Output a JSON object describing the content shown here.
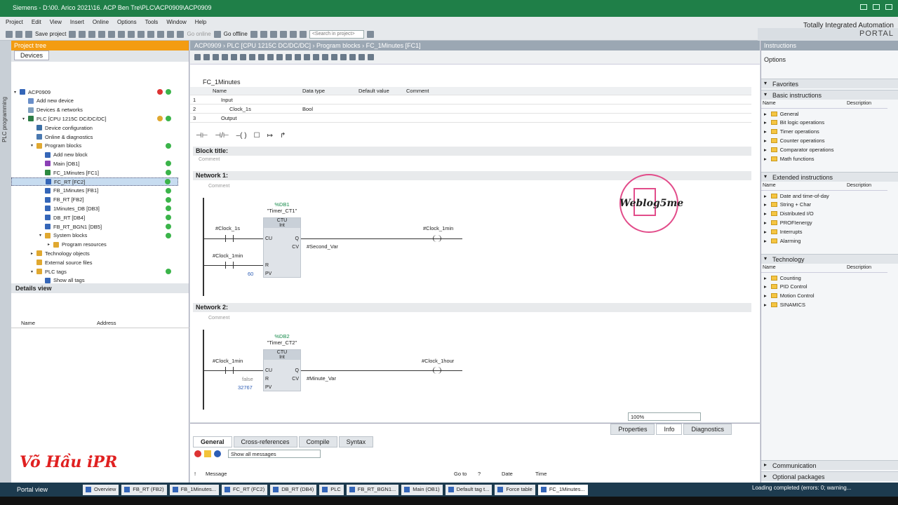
{
  "window": {
    "title": "Siemens - D:\\00. Arico 2021\\16. ACP Ben Tre\\PLC\\ACP0909\\ACP0909"
  },
  "menu": [
    "Project",
    "Edit",
    "View",
    "Insert",
    "Online",
    "Options",
    "Tools",
    "Window",
    "Help"
  ],
  "toolbar": {
    "save": "Save project",
    "go_online": "Go online",
    "go_offline": "Go offline",
    "search_placeholder": "<Search in project>"
  },
  "brand": {
    "line1": "Totally Integrated Automation",
    "line2": "PORTAL"
  },
  "leftstrip": {
    "label": "PLC programming"
  },
  "project_tree": {
    "header": "Project tree",
    "tab": "Devices",
    "items": [
      {
        "label": "ACP0909",
        "indent": 0,
        "status": "both"
      },
      {
        "label": "Add new device",
        "indent": 1,
        "status": ""
      },
      {
        "label": "Devices & networks",
        "indent": 1,
        "status": ""
      },
      {
        "label": "PLC [CPU 1215C DC/DC/DC]",
        "indent": 1,
        "status": "both2"
      },
      {
        "label": "Device configuration",
        "indent": 2,
        "status": ""
      },
      {
        "label": "Online & diagnostics",
        "indent": 2,
        "status": ""
      },
      {
        "label": "Program blocks",
        "indent": 2,
        "status": "ok"
      },
      {
        "label": "Add new block",
        "indent": 3,
        "status": ""
      },
      {
        "label": "Main [OB1]",
        "indent": 3,
        "status": "ok"
      },
      {
        "label": "FC_1Minutes [FC1]",
        "indent": 3,
        "status": "ok"
      },
      {
        "label": "FC_RT [FC2]",
        "indent": 3,
        "status": "ok",
        "selected": true
      },
      {
        "label": "FB_1Minutes [FB1]",
        "indent": 3,
        "status": "ok"
      },
      {
        "label": "FB_RT [FB2]",
        "indent": 3,
        "status": "ok"
      },
      {
        "label": "1Minutes_DB [DB3]",
        "indent": 3,
        "status": "ok"
      },
      {
        "label": "DB_RT [DB4]",
        "indent": 3,
        "status": "ok"
      },
      {
        "label": "FB_RT_BGN1 [DB5]",
        "indent": 3,
        "status": "ok"
      },
      {
        "label": "System blocks",
        "indent": 3,
        "status": "ok"
      },
      {
        "label": "Program resources",
        "indent": 4,
        "status": ""
      },
      {
        "label": "Technology objects",
        "indent": 2,
        "status": ""
      },
      {
        "label": "External source files",
        "indent": 2,
        "status": ""
      },
      {
        "label": "PLC tags",
        "indent": 2,
        "status": "ok"
      },
      {
        "label": "Show all tags",
        "indent": 3,
        "status": ""
      }
    ]
  },
  "details_view": {
    "header": "Details view",
    "col_name": "Name",
    "col_address": "Address"
  },
  "editor": {
    "breadcrumb": "ACP0909  ›  PLC [CPU 1215C DC/DC/DC]  ›  Program blocks  ›  FC_1Minutes [FC1]",
    "block_name": "FC_1Minutes",
    "interface_cols": [
      "Name",
      "Data type",
      "Default value",
      "Comment"
    ],
    "interface_rows": [
      {
        "num": "1",
        "name": "Input",
        "type": ""
      },
      {
        "num": "2",
        "name": "Clock_1s",
        "type": "Bool"
      },
      {
        "num": "3",
        "name": "Output",
        "type": ""
      }
    ],
    "block_title_label": "Block title:",
    "comment": "Comment",
    "network1": {
      "label": "Network 1:",
      "db_addr": "%DB1",
      "db_name": "\"Timer_CT1\"",
      "block_type": "CTU",
      "block_dtype": "Int",
      "pin_cu": "CU",
      "pin_r": "R",
      "pin_pv": "PV",
      "pin_q": "Q",
      "pin_cv": "CV",
      "in_cu": "#Clock_1s",
      "in_r": "#Clock_1min",
      "in_pv": "60",
      "out_q": "#Clock_1min",
      "out_cv": "#Second_Var"
    },
    "network2": {
      "label": "Network 2:",
      "db_addr": "%DB2",
      "db_name": "\"Timer_CT2\"",
      "block_type": "CTU",
      "block_dtype": "Int",
      "pin_cu": "CU",
      "pin_r": "R",
      "pin_pv": "PV",
      "pin_q": "Q",
      "pin_cv": "CV",
      "in_cu": "#Clock_1min",
      "in_r": "false",
      "in_pv": "32767",
      "out_q": "#Clock_1hour",
      "out_cv": "#Minute_Var"
    },
    "zoom": "100%",
    "logo_text": "Weblog5me"
  },
  "instructions": {
    "header": "Instructions",
    "options": "Options",
    "favorites": "Favorites",
    "basic": {
      "label": "Basic instructions",
      "col_name": "Name",
      "col_desc": "Description",
      "items": [
        "General",
        "Bit logic operations",
        "Timer operations",
        "Counter operations",
        "Comparator operations",
        "Math functions"
      ]
    },
    "extended": {
      "label": "Extended instructions",
      "col_name": "Name",
      "col_desc": "Description",
      "items": [
        "Date and time-of-day",
        "String + Char",
        "Distributed I/O",
        "PROFIenergy",
        "Interrupts",
        "Alarming"
      ]
    },
    "technology": {
      "label": "Technology",
      "col_name": "Name",
      "col_desc": "Description",
      "items": [
        "Counting",
        "PID Control",
        "Motion Control",
        "SINAMICS"
      ]
    },
    "communication": "Communication",
    "optional": "Optional packages"
  },
  "inspector": {
    "tabs": [
      "Properties",
      "Info",
      "Diagnostics"
    ],
    "subtabs": [
      "General",
      "Cross-references",
      "Compile",
      "Syntax"
    ],
    "filter": "Show all messages",
    "cols": [
      "!",
      "Message",
      "Go to",
      "?",
      "Date",
      "Time"
    ]
  },
  "taskbar": {
    "portal_view": "Portal view",
    "tasks": [
      "Overview",
      "FB_RT (FB2)",
      "FB_1Minutes...",
      "FC_RT (FC2)",
      "DB_RT (DB4)",
      "PLC",
      "FB_RT_BGN1...",
      "Main (OB1)",
      "Default tag t...",
      "Force table",
      "FC_1Minutes..."
    ],
    "status": "Loading completed (errors: 0; warning..."
  },
  "signature": "Võ Hầu iPR"
}
